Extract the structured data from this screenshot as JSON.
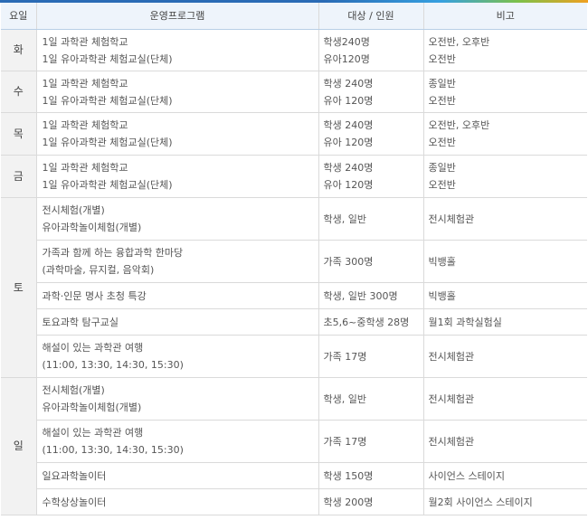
{
  "header": {
    "day": "요일",
    "program": "운영프로그램",
    "target": "대상 / 인원",
    "note": "비고"
  },
  "days": {
    "tue": "화",
    "wed": "수",
    "thu": "목",
    "fri": "금",
    "sat": "토",
    "sun": "일"
  },
  "rows": [
    {
      "program": [
        "1일 과학관 체험학교",
        "1일 유아과학관 체험교실(단체)"
      ],
      "target": [
        "학생240명",
        "유아120명"
      ],
      "note": [
        "오전반, 오후반",
        "오전반"
      ]
    },
    {
      "program": [
        "1일 과학관 체험학교",
        "1일 유아과학관 체험교실(단체)"
      ],
      "target": [
        "학생 240명",
        "유아 120명"
      ],
      "note": [
        "종일반",
        "오전반"
      ]
    },
    {
      "program": [
        "1일 과학관 체험학교",
        "1일 유아과학관 체험교실(단체)"
      ],
      "target": [
        "학생 240명",
        "유아 120명"
      ],
      "note": [
        "오전반, 오후반",
        "오전반"
      ]
    },
    {
      "program": [
        "1일 과학관 체험학교",
        "1일 유아과학관 체험교실(단체)"
      ],
      "target": [
        "학생 240명",
        "유아 120명"
      ],
      "note": [
        "종일반",
        "오전반"
      ]
    },
    {
      "program": [
        "전시체험(개별)",
        "유아과학놀이체험(개별)"
      ],
      "target": [
        "학생, 일반"
      ],
      "note": [
        "전시체험관"
      ]
    },
    {
      "program": [
        "가족과 함께 하는 융합과학 한마당",
        "(과학마술, 뮤지컬, 음악회)"
      ],
      "target": [
        "가족 300명"
      ],
      "note": [
        "빅뱅홀"
      ]
    },
    {
      "program": [
        "과학·인문 명사 초청 특강"
      ],
      "target": [
        "학생, 일반 300명"
      ],
      "note": [
        "빅뱅홀"
      ]
    },
    {
      "program": [
        "토요과학 탐구교실"
      ],
      "target": [
        "초5,6~중학생 28명"
      ],
      "note": [
        "월1회 과학실험실"
      ]
    },
    {
      "program": [
        "해설이 있는 과학관 여행",
        "(11:00, 13:30, 14:30, 15:30)"
      ],
      "target": [
        "가족 17명"
      ],
      "note": [
        "전시체험관"
      ]
    },
    {
      "program": [
        "전시체험(개별)",
        "유아과학놀이체험(개별)"
      ],
      "target": [
        "학생, 일반"
      ],
      "note": [
        "전시체험관"
      ]
    },
    {
      "program": [
        "해설이 있는 과학관 여행",
        "(11:00, 13:30, 14:30, 15:30)"
      ],
      "target": [
        "가족 17명"
      ],
      "note": [
        "전시체험관"
      ]
    },
    {
      "program": [
        "일요과학놀이터"
      ],
      "target": [
        "학생 150명"
      ],
      "note": [
        "사이언스 스테이지"
      ]
    },
    {
      "program": [
        "수학상상놀이터"
      ],
      "target": [
        "학생 200명"
      ],
      "note": [
        "월2회 사이언스 스테이지"
      ]
    }
  ]
}
